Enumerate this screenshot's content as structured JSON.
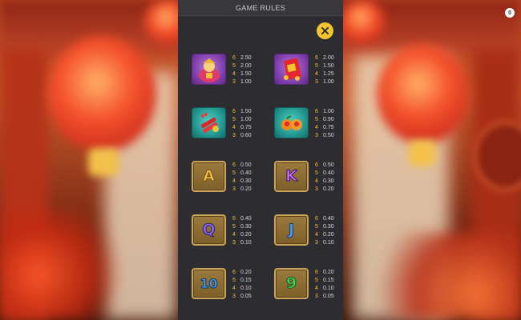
{
  "header": {
    "title": "GAME RULES"
  },
  "corner_badge": {
    "text": "0"
  },
  "close_button": {
    "icon": "close-icon"
  },
  "paytable": [
    {
      "symbol": "fortune-god",
      "pays": [
        {
          "count": "6",
          "value": "2.50"
        },
        {
          "count": "5",
          "value": "2.00"
        },
        {
          "count": "4",
          "value": "1.50"
        },
        {
          "count": "3",
          "value": "1.00"
        }
      ]
    },
    {
      "symbol": "red-envelope",
      "pays": [
        {
          "count": "6",
          "value": "2.00"
        },
        {
          "count": "5",
          "value": "1.50"
        },
        {
          "count": "4",
          "value": "1.25"
        },
        {
          "count": "3",
          "value": "1.00"
        }
      ]
    },
    {
      "symbol": "firecrackers",
      "pays": [
        {
          "count": "6",
          "value": "1.50"
        },
        {
          "count": "5",
          "value": "1.00"
        },
        {
          "count": "4",
          "value": "0.75"
        },
        {
          "count": "3",
          "value": "0.60"
        }
      ]
    },
    {
      "symbol": "mandarin-oranges",
      "pays": [
        {
          "count": "6",
          "value": "1.00"
        },
        {
          "count": "5",
          "value": "0.90"
        },
        {
          "count": "4",
          "value": "0.75"
        },
        {
          "count": "3",
          "value": "0.50"
        }
      ]
    },
    {
      "symbol": "A",
      "pays": [
        {
          "count": "6",
          "value": "0.50"
        },
        {
          "count": "5",
          "value": "0.40"
        },
        {
          "count": "4",
          "value": "0.30"
        },
        {
          "count": "3",
          "value": "0.20"
        }
      ]
    },
    {
      "symbol": "K",
      "pays": [
        {
          "count": "6",
          "value": "0.50"
        },
        {
          "count": "5",
          "value": "0.40"
        },
        {
          "count": "4",
          "value": "0.30"
        },
        {
          "count": "3",
          "value": "0.20"
        }
      ]
    },
    {
      "symbol": "Q",
      "pays": [
        {
          "count": "6",
          "value": "0.40"
        },
        {
          "count": "5",
          "value": "0.30"
        },
        {
          "count": "4",
          "value": "0.20"
        },
        {
          "count": "3",
          "value": "0.10"
        }
      ]
    },
    {
      "symbol": "J",
      "pays": [
        {
          "count": "6",
          "value": "0.40"
        },
        {
          "count": "5",
          "value": "0.30"
        },
        {
          "count": "4",
          "value": "0.20"
        },
        {
          "count": "3",
          "value": "0.10"
        }
      ]
    },
    {
      "symbol": "10",
      "pays": [
        {
          "count": "6",
          "value": "0.20"
        },
        {
          "count": "5",
          "value": "0.15"
        },
        {
          "count": "4",
          "value": "0.10"
        },
        {
          "count": "3",
          "value": "0.05"
        }
      ]
    },
    {
      "symbol": "9",
      "pays": [
        {
          "count": "6",
          "value": "0.20"
        },
        {
          "count": "5",
          "value": "0.15"
        },
        {
          "count": "4",
          "value": "0.10"
        },
        {
          "count": "3",
          "value": "0.05"
        }
      ]
    }
  ],
  "colors": {
    "accent": "#f3c332",
    "panel_bg": "#2c2c31",
    "count_color": "#f0c435",
    "value_color": "#d6d6d6"
  }
}
